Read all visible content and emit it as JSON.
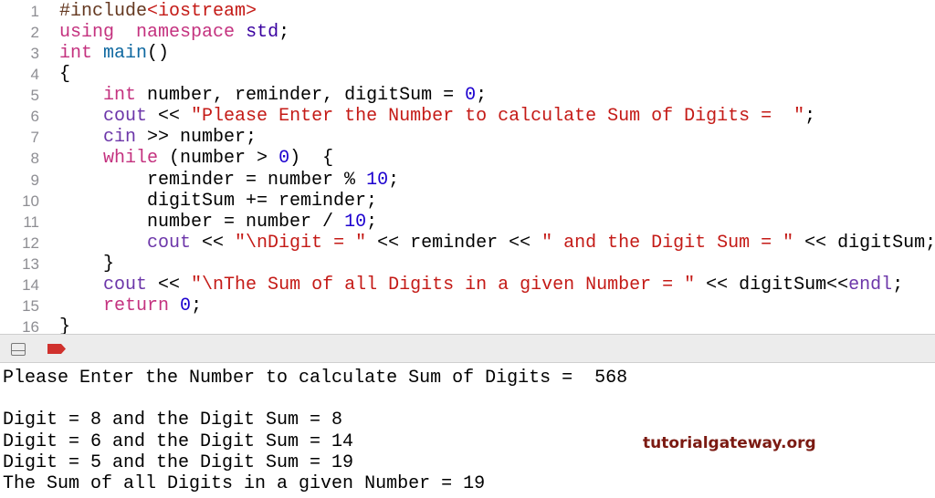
{
  "editor": {
    "lines": [
      {
        "n": "1",
        "tokens": [
          [
            "pp",
            "#include"
          ],
          [
            "str",
            "<iostream>"
          ]
        ]
      },
      {
        "n": "2",
        "tokens": [
          [
            "kw",
            "using"
          ],
          [
            "",
            "  "
          ],
          [
            "kw",
            "namespace"
          ],
          [
            "",
            " "
          ],
          [
            "ns",
            "std"
          ],
          [
            "",
            ";"
          ]
        ]
      },
      {
        "n": "3",
        "tokens": [
          [
            "kw",
            "int"
          ],
          [
            "",
            " "
          ],
          [
            "fn",
            "main"
          ],
          [
            "",
            "()"
          ]
        ]
      },
      {
        "n": "4",
        "tokens": [
          [
            "",
            "{"
          ]
        ]
      },
      {
        "n": "5",
        "tokens": [
          [
            "",
            "    "
          ],
          [
            "kw",
            "int"
          ],
          [
            "",
            " number, reminder, digitSum = "
          ],
          [
            "num",
            "0"
          ],
          [
            "",
            ";"
          ]
        ]
      },
      {
        "n": "6",
        "tokens": [
          [
            "",
            "    "
          ],
          [
            "lib",
            "cout"
          ],
          [
            "",
            " << "
          ],
          [
            "str",
            "\"Please Enter the Number to calculate Sum of Digits =  \""
          ],
          [
            "",
            ";"
          ]
        ]
      },
      {
        "n": "7",
        "tokens": [
          [
            "",
            "    "
          ],
          [
            "lib",
            "cin"
          ],
          [
            "",
            " >> number;"
          ]
        ]
      },
      {
        "n": "8",
        "tokens": [
          [
            "",
            "    "
          ],
          [
            "kw",
            "while"
          ],
          [
            "",
            " (number > "
          ],
          [
            "num",
            "0"
          ],
          [
            "",
            ")  {"
          ]
        ]
      },
      {
        "n": "9",
        "tokens": [
          [
            "",
            "        reminder = number % "
          ],
          [
            "num",
            "10"
          ],
          [
            "",
            ";"
          ]
        ]
      },
      {
        "n": "10",
        "tokens": [
          [
            "",
            "        digitSum += reminder;"
          ]
        ]
      },
      {
        "n": "11",
        "tokens": [
          [
            "",
            "        number = number / "
          ],
          [
            "num",
            "10"
          ],
          [
            "",
            ";"
          ]
        ]
      },
      {
        "n": "12",
        "tokens": [
          [
            "",
            "        "
          ],
          [
            "lib",
            "cout"
          ],
          [
            "",
            " << "
          ],
          [
            "str",
            "\"\\nDigit = \""
          ],
          [
            "",
            " << reminder << "
          ],
          [
            "str",
            "\" and the Digit Sum = \""
          ],
          [
            "",
            " << digitSum;"
          ]
        ]
      },
      {
        "n": "13",
        "tokens": [
          [
            "",
            "    }"
          ]
        ]
      },
      {
        "n": "14",
        "tokens": [
          [
            "",
            "    "
          ],
          [
            "lib",
            "cout"
          ],
          [
            "",
            " << "
          ],
          [
            "str",
            "\"\\nThe Sum of all Digits in a given Number = \""
          ],
          [
            "",
            " << digitSum<<"
          ],
          [
            "lib",
            "endl"
          ],
          [
            "",
            ";"
          ]
        ]
      },
      {
        "n": "15",
        "tokens": [
          [
            "",
            "    "
          ],
          [
            "kw",
            "return"
          ],
          [
            "",
            " "
          ],
          [
            "num",
            "0"
          ],
          [
            "",
            ";"
          ]
        ]
      },
      {
        "n": "16",
        "tokens": [
          [
            "",
            "}"
          ]
        ]
      }
    ]
  },
  "toolbar": {
    "panel_icon": "bottom-panel-icon",
    "breakpoint_icon": "breakpoint-icon",
    "breakpoint_color": "#d0312d"
  },
  "console": {
    "lines": [
      "Please Enter the Number to calculate Sum of Digits =  568",
      "",
      "Digit = 8 and the Digit Sum = 8",
      "Digit = 6 and the Digit Sum = 14",
      "Digit = 5 and the Digit Sum = 19",
      "The Sum of all Digits in a given Number = 19"
    ]
  },
  "watermark": "tutorialgateway.org"
}
